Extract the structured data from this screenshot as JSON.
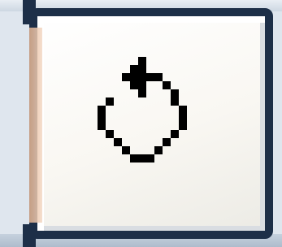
{
  "toolbar": {
    "refresh_button": {
      "icon": "refresh-icon",
      "tooltip": ""
    }
  },
  "colors": {
    "border": "#1d2f48",
    "face": "#f9f7f2",
    "icon": "#000000",
    "highlight": "#e3b18e"
  }
}
